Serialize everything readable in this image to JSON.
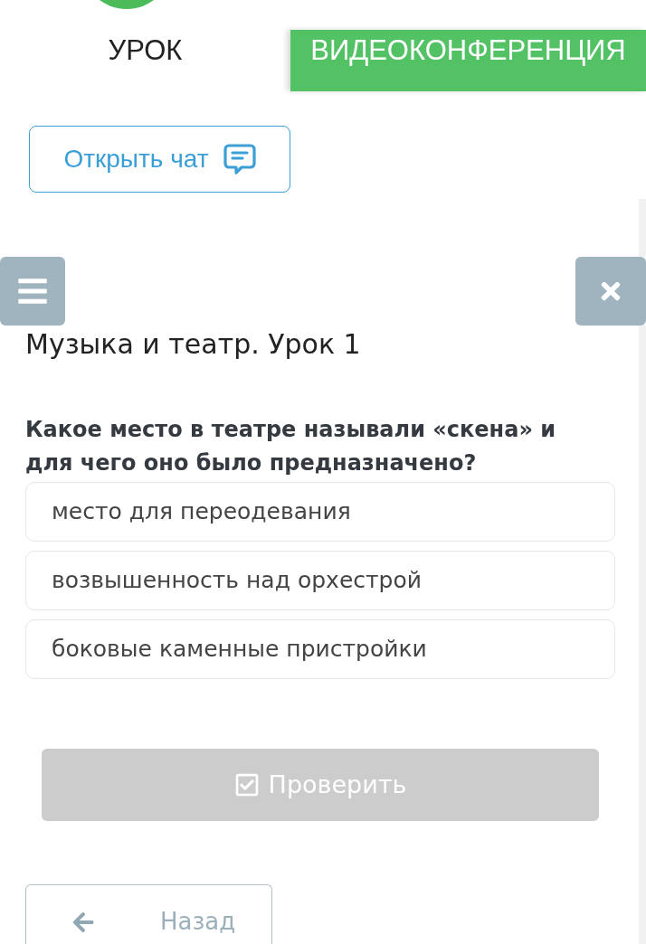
{
  "header": {
    "tabs": [
      {
        "label": "УРОК",
        "selected": false
      },
      {
        "label": "ВИДЕОКОНФЕРЕНЦИЯ",
        "selected": true
      }
    ]
  },
  "chat_button": {
    "label": "Открыть чат"
  },
  "lesson": {
    "title": "Музыка и театр. Урок 1"
  },
  "question": {
    "text": "Какое место в театре называли «скена» и для чего оно было предназначено?",
    "options": [
      {
        "label": "место для переодевания",
        "selected": false
      },
      {
        "label": "возвышенность над орхестрой",
        "selected": false
      },
      {
        "label": "боковые каменные пристройки",
        "selected": false
      }
    ]
  },
  "check_button": {
    "label": "Проверить",
    "disabled": true
  },
  "back_button": {
    "label": "Назад"
  }
}
